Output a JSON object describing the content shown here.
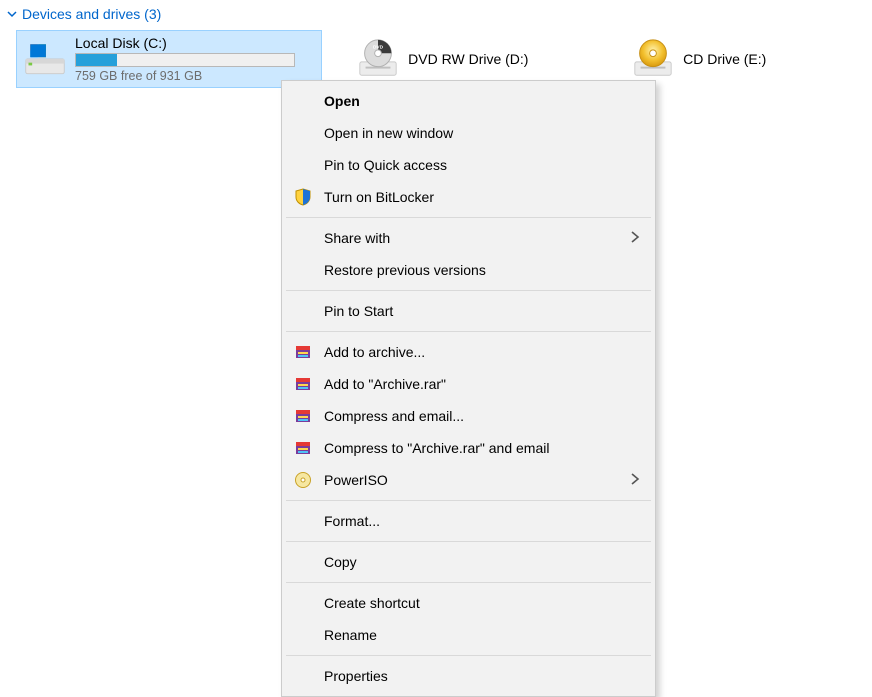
{
  "section": {
    "title": "Devices and drives (3)"
  },
  "drives": [
    {
      "name": "Local Disk (C:)",
      "free_label": "759 GB free of 931 GB",
      "usage_pct": 19
    },
    {
      "name": "DVD RW Drive (D:)"
    },
    {
      "name": "CD Drive (E:)"
    }
  ],
  "ctx": {
    "open": "Open",
    "open_new": "Open in new window",
    "pin_quick": "Pin to Quick access",
    "bitlocker": "Turn on BitLocker",
    "share_with": "Share with",
    "restore_ver": "Restore previous versions",
    "pin_start": "Pin to Start",
    "add_archive": "Add to archive...",
    "add_rar": "Add to \"Archive.rar\"",
    "comp_email": "Compress and email...",
    "comp_rar_em": "Compress to \"Archive.rar\" and email",
    "poweriso": "PowerISO",
    "format": "Format...",
    "copy": "Copy",
    "create_sc": "Create shortcut",
    "rename": "Rename",
    "properties": "Properties"
  }
}
